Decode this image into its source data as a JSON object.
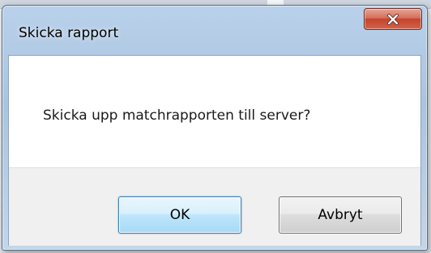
{
  "dialog": {
    "title": "Skicka rapport",
    "message": "Skicka upp matchrapporten till server?",
    "buttons": {
      "ok_label": "OK",
      "cancel_label": "Avbryt"
    },
    "close_icon": "close-x-icon"
  },
  "colors": {
    "titlebar": "#b9d1ea",
    "close_button": "#c4442c",
    "content_bg": "#ffffff",
    "footer_bg": "#f0f0f0",
    "ok_border": "#3c7fb1"
  }
}
